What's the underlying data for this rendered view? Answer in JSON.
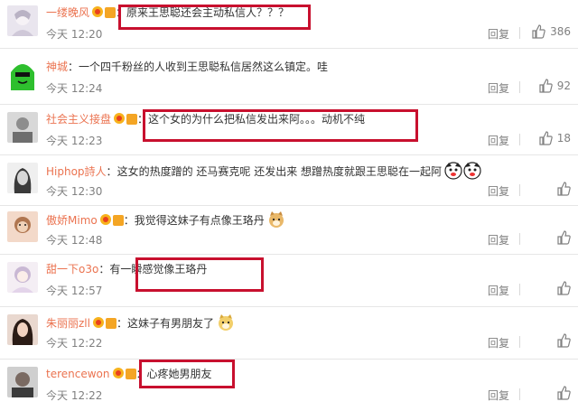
{
  "comments": [
    {
      "user": "一缕晚风",
      "text": "原来王思聪还会主动私信人？？？",
      "time": "今天 12:20",
      "reply": "回复",
      "likes": "386"
    },
    {
      "user": "神城",
      "text": "一个四千粉丝的人收到王思聪私信居然这么镇定。哇",
      "time": "今天 12:24",
      "reply": "回复",
      "likes": "92"
    },
    {
      "user": "社会主义接盘",
      "text": "这个女的为什么把私信发出来阿。。。动机不纯",
      "time": "今天 12:23",
      "reply": "回复",
      "likes": "18"
    },
    {
      "user": "Hiphop詩人",
      "text": "这女的热度蹭的 还马赛克呢 还发出来 想蹭热度就跟王思聪在一起阿",
      "time": "今天 12:30",
      "reply": "回复",
      "likes": ""
    },
    {
      "user": "傲娇Mimo",
      "text": "我觉得这妹子有点像王珞丹",
      "time": "今天 12:48",
      "reply": "回复",
      "likes": ""
    },
    {
      "user": "甜一下o3o",
      "text": "有一瞬感觉像王珞丹",
      "time": "今天 12:57",
      "reply": "回复",
      "likes": ""
    },
    {
      "user": "朱丽丽zll",
      "text": "这妹子有男朋友了",
      "time": "今天 12:22",
      "reply": "回复",
      "likes": ""
    },
    {
      "user": "terencewon",
      "text": "心疼她男朋友",
      "time": "今天 12:22",
      "reply": "回复",
      "likes": ""
    }
  ],
  "colors": {
    "username": "#eb7350",
    "highlight": "#c8102e",
    "meta": "#808080"
  }
}
